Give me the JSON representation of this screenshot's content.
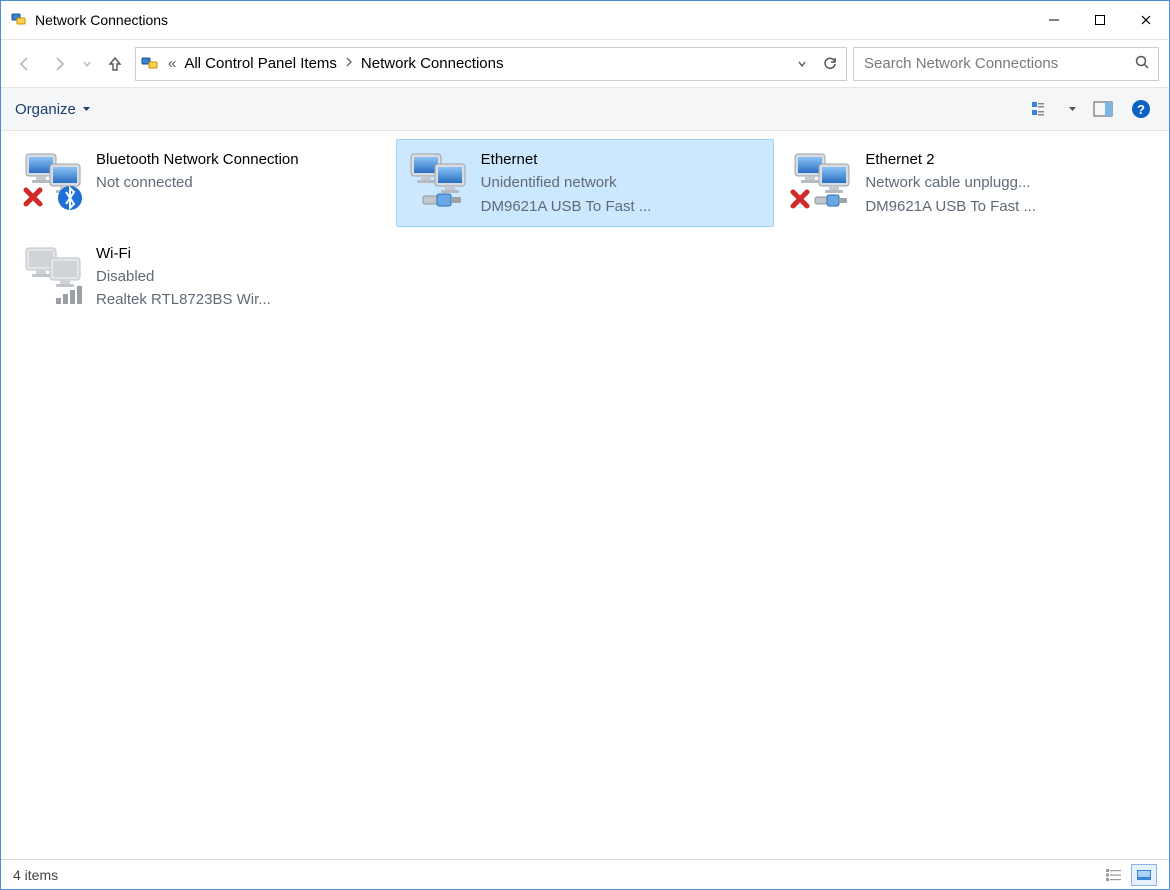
{
  "window": {
    "title": "Network Connections"
  },
  "breadcrumbs": {
    "parent": "All Control Panel Items",
    "current": "Network Connections",
    "overflow_glyph": "«"
  },
  "search": {
    "placeholder": "Search Network Connections"
  },
  "commandbar": {
    "organize": "Organize"
  },
  "items": [
    {
      "name": "Bluetooth Network Connection",
      "status": "Not connected",
      "detail": "",
      "icon": "network-pair",
      "overlay": "x-bluetooth",
      "selected": false
    },
    {
      "name": "Ethernet",
      "status": "Unidentified network",
      "detail": "DM9621A USB To Fast ...",
      "icon": "network-pair",
      "overlay": "cable",
      "selected": true
    },
    {
      "name": "Ethernet 2",
      "status": "Network cable unplugg...",
      "detail": "DM9621A USB To Fast ...",
      "icon": "network-pair",
      "overlay": "x-cable",
      "selected": false
    },
    {
      "name": "Wi-Fi",
      "status": "Disabled",
      "detail": "Realtek RTL8723BS Wir...",
      "icon": "network-pair-dim",
      "overlay": "wifi-dim",
      "selected": false
    }
  ],
  "statusbar": {
    "count_text": "4 items"
  }
}
